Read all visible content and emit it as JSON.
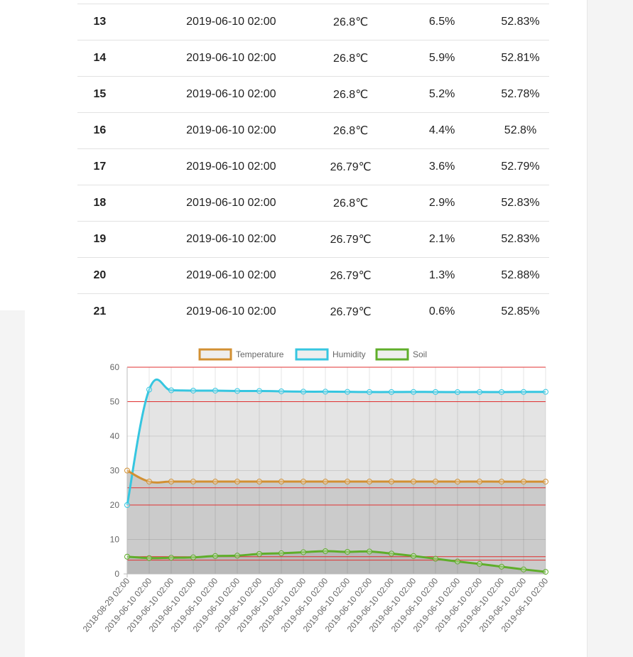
{
  "table": {
    "rows": [
      {
        "id": "13",
        "time": "2019-06-10 02:00",
        "temperature": "26.8℃",
        "humidity": "6.5%",
        "soil": "52.83%"
      },
      {
        "id": "14",
        "time": "2019-06-10 02:00",
        "temperature": "26.8℃",
        "humidity": "5.9%",
        "soil": "52.81%"
      },
      {
        "id": "15",
        "time": "2019-06-10 02:00",
        "temperature": "26.8℃",
        "humidity": "5.2%",
        "soil": "52.78%"
      },
      {
        "id": "16",
        "time": "2019-06-10 02:00",
        "temperature": "26.8℃",
        "humidity": "4.4%",
        "soil": "52.8%"
      },
      {
        "id": "17",
        "time": "2019-06-10 02:00",
        "temperature": "26.79℃",
        "humidity": "3.6%",
        "soil": "52.79%"
      },
      {
        "id": "18",
        "time": "2019-06-10 02:00",
        "temperature": "26.8℃",
        "humidity": "2.9%",
        "soil": "52.83%"
      },
      {
        "id": "19",
        "time": "2019-06-10 02:00",
        "temperature": "26.79℃",
        "humidity": "2.1%",
        "soil": "52.83%"
      },
      {
        "id": "20",
        "time": "2019-06-10 02:00",
        "temperature": "26.79℃",
        "humidity": "1.3%",
        "soil": "52.88%"
      },
      {
        "id": "21",
        "time": "2019-06-10 02:00",
        "temperature": "26.79℃",
        "humidity": "0.6%",
        "soil": "52.85%"
      }
    ]
  },
  "chart_data": {
    "type": "line",
    "title": "",
    "xlabel": "",
    "ylabel": "",
    "ylim": [
      0,
      60
    ],
    "yticks": [
      0,
      10,
      20,
      30,
      40,
      50,
      60
    ],
    "grid": true,
    "legend_position": "top",
    "categories": [
      "2018-08-29 02:00",
      "2019-06-10 02:00",
      "2019-06-10 02:00",
      "2019-06-10 02:00",
      "2019-06-10 02:00",
      "2019-06-10 02:00",
      "2019-06-10 02:00",
      "2019-06-10 02:00",
      "2019-06-10 02:00",
      "2019-06-10 02:00",
      "2019-06-10 02:00",
      "2019-06-10 02:00",
      "2019-06-10 02:00",
      "2019-06-10 02:00",
      "2019-06-10 02:00",
      "2019-06-10 02:00",
      "2019-06-10 02:00",
      "2019-06-10 02:00",
      "2019-06-10 02:00",
      "2019-06-10 02:00"
    ],
    "series": [
      {
        "name": "Temperature",
        "color": "#d29033",
        "values": [
          30,
          26.8,
          26.8,
          26.8,
          26.8,
          26.8,
          26.8,
          26.8,
          26.8,
          26.8,
          26.8,
          26.8,
          26.8,
          26.8,
          26.8,
          26.79,
          26.8,
          26.79,
          26.79,
          26.79
        ]
      },
      {
        "name": "Humidity",
        "color": "#36c6e0",
        "values": [
          20,
          53.5,
          53.3,
          53.2,
          53.2,
          53.1,
          53.1,
          53.0,
          52.9,
          52.9,
          52.85,
          52.8,
          52.8,
          52.83,
          52.81,
          52.78,
          52.8,
          52.79,
          52.83,
          52.85
        ]
      },
      {
        "name": "Soil",
        "color": "#5fae2a",
        "values": [
          5,
          4.6,
          4.7,
          4.8,
          5.2,
          5.3,
          5.8,
          6.0,
          6.3,
          6.6,
          6.4,
          6.5,
          5.9,
          5.2,
          4.4,
          3.6,
          2.9,
          2.1,
          1.3,
          0.6
        ]
      }
    ],
    "reference_lines": [
      {
        "y": 50,
        "color": "#e03030"
      },
      {
        "y": 25,
        "color": "#e03030"
      },
      {
        "y": 20,
        "color": "#e03030"
      },
      {
        "y": 5,
        "color": "#e03030"
      },
      {
        "y": 4,
        "color": "#e03030"
      }
    ],
    "band_colors": {
      "top": "#e4e4e4",
      "middle": "#cbcbcb",
      "bottom": "#b9b9b9"
    }
  }
}
